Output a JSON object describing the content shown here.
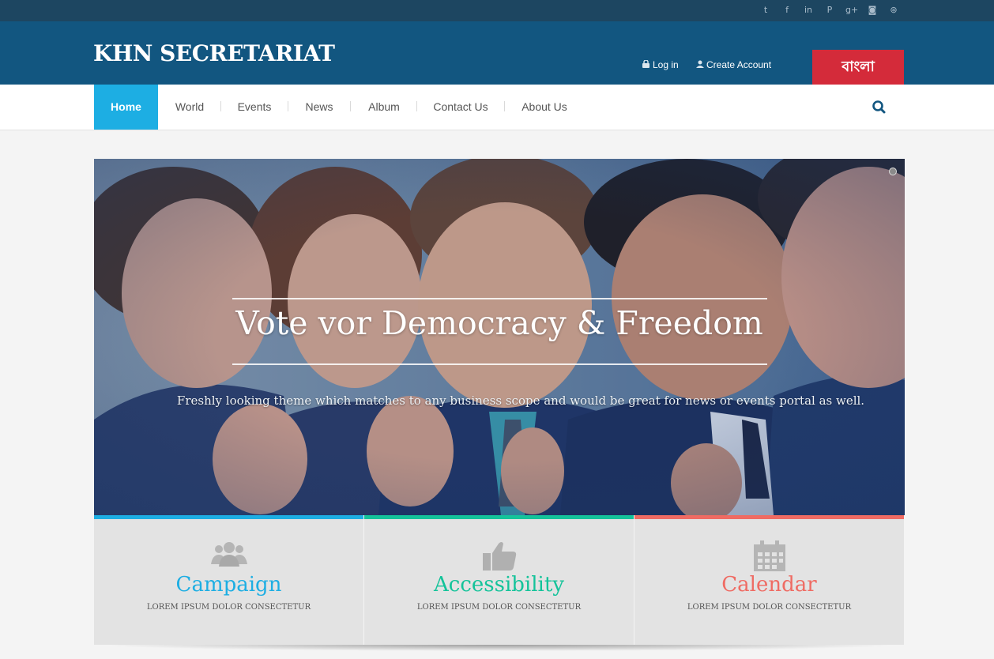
{
  "social": {
    "twitter": "t",
    "facebook": "f",
    "linkedin": "in",
    "pinterest": "P",
    "googleplus": "g+",
    "instagram": "◙",
    "dribbble": "⊛"
  },
  "header": {
    "site_title": "KHN SECRETARIAT",
    "login_label": "Log in",
    "create_account_label": "Create Account",
    "language_button": "বাংলা",
    "bg_color": "#125680",
    "topbar_color": "#1d4661",
    "language_button_color": "#d42b3a"
  },
  "nav": {
    "items": [
      "Home",
      "World",
      "Events",
      "News",
      "Album",
      "Contact Us",
      "About Us"
    ],
    "active": "Home",
    "active_color": "#1daee3"
  },
  "hero": {
    "title": "Vote vor Democracy & Freedom",
    "subtitle": "Freshly looking theme which matches to any business scope and would be great for news or events portal as well."
  },
  "features": [
    {
      "title": "Campaign",
      "subtitle": "LOREM IPSUM DOLOR CONSECTETUR",
      "icon": "users-icon",
      "color": "#1daee3"
    },
    {
      "title": "Accessibility",
      "subtitle": "LOREM IPSUM DOLOR CONSECTETUR",
      "icon": "thumbs-up-icon",
      "color": "#14c39a"
    },
    {
      "title": "Calendar",
      "subtitle": "LOREM IPSUM DOLOR CONSECTETUR",
      "icon": "calendar-icon",
      "color": "#ef6b63"
    }
  ]
}
